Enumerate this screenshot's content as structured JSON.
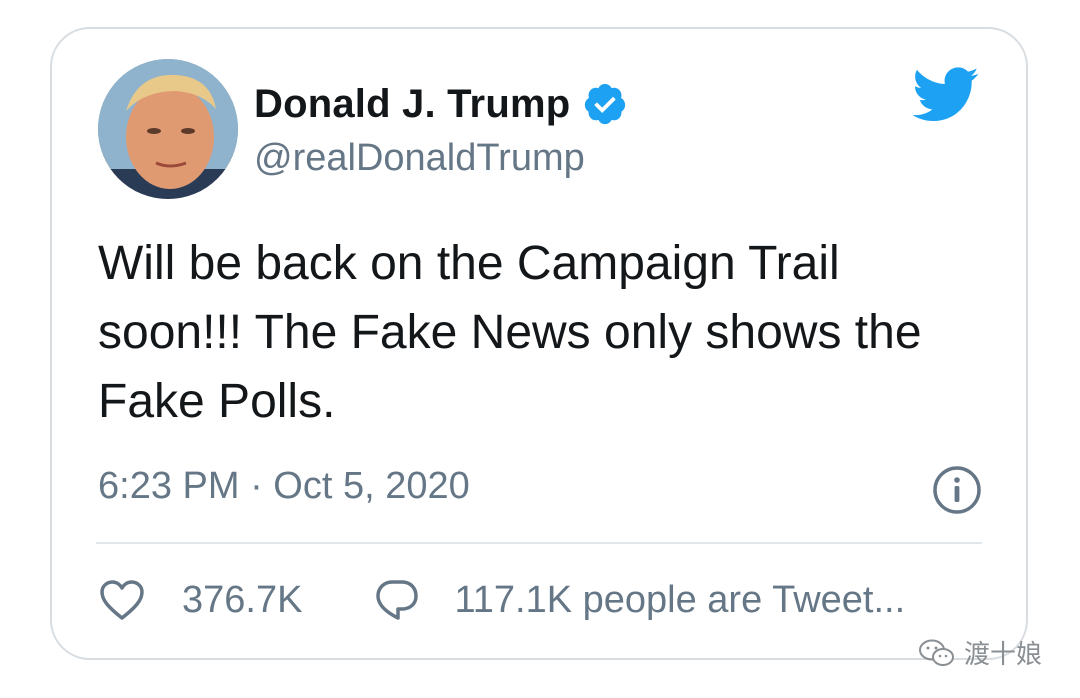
{
  "tweet": {
    "author": {
      "display_name": "Donald J. Trump",
      "handle": "@realDonaldTrump",
      "verified_icon": "verified-badge-icon",
      "avatar": "profile-photo"
    },
    "brand_icon": "twitter-bird-icon",
    "text": "Will be back on the Campaign Trail soon!!! The Fake News only shows the Fake Polls.",
    "timestamp": "6:23 PM · Oct 5, 2020",
    "info_icon": "info-icon",
    "likes": {
      "icon": "heart-icon",
      "count": "376.7K"
    },
    "replies": {
      "icon": "reply-bubble-icon",
      "label": "117.1K people are Tweet..."
    }
  },
  "watermark": {
    "icon": "wechat-icon",
    "text": "渡十娘"
  },
  "colors": {
    "twitter_blue": "#1da1f2",
    "text_primary": "#14171a",
    "text_secondary": "#657786",
    "border": "#d8dde2"
  }
}
